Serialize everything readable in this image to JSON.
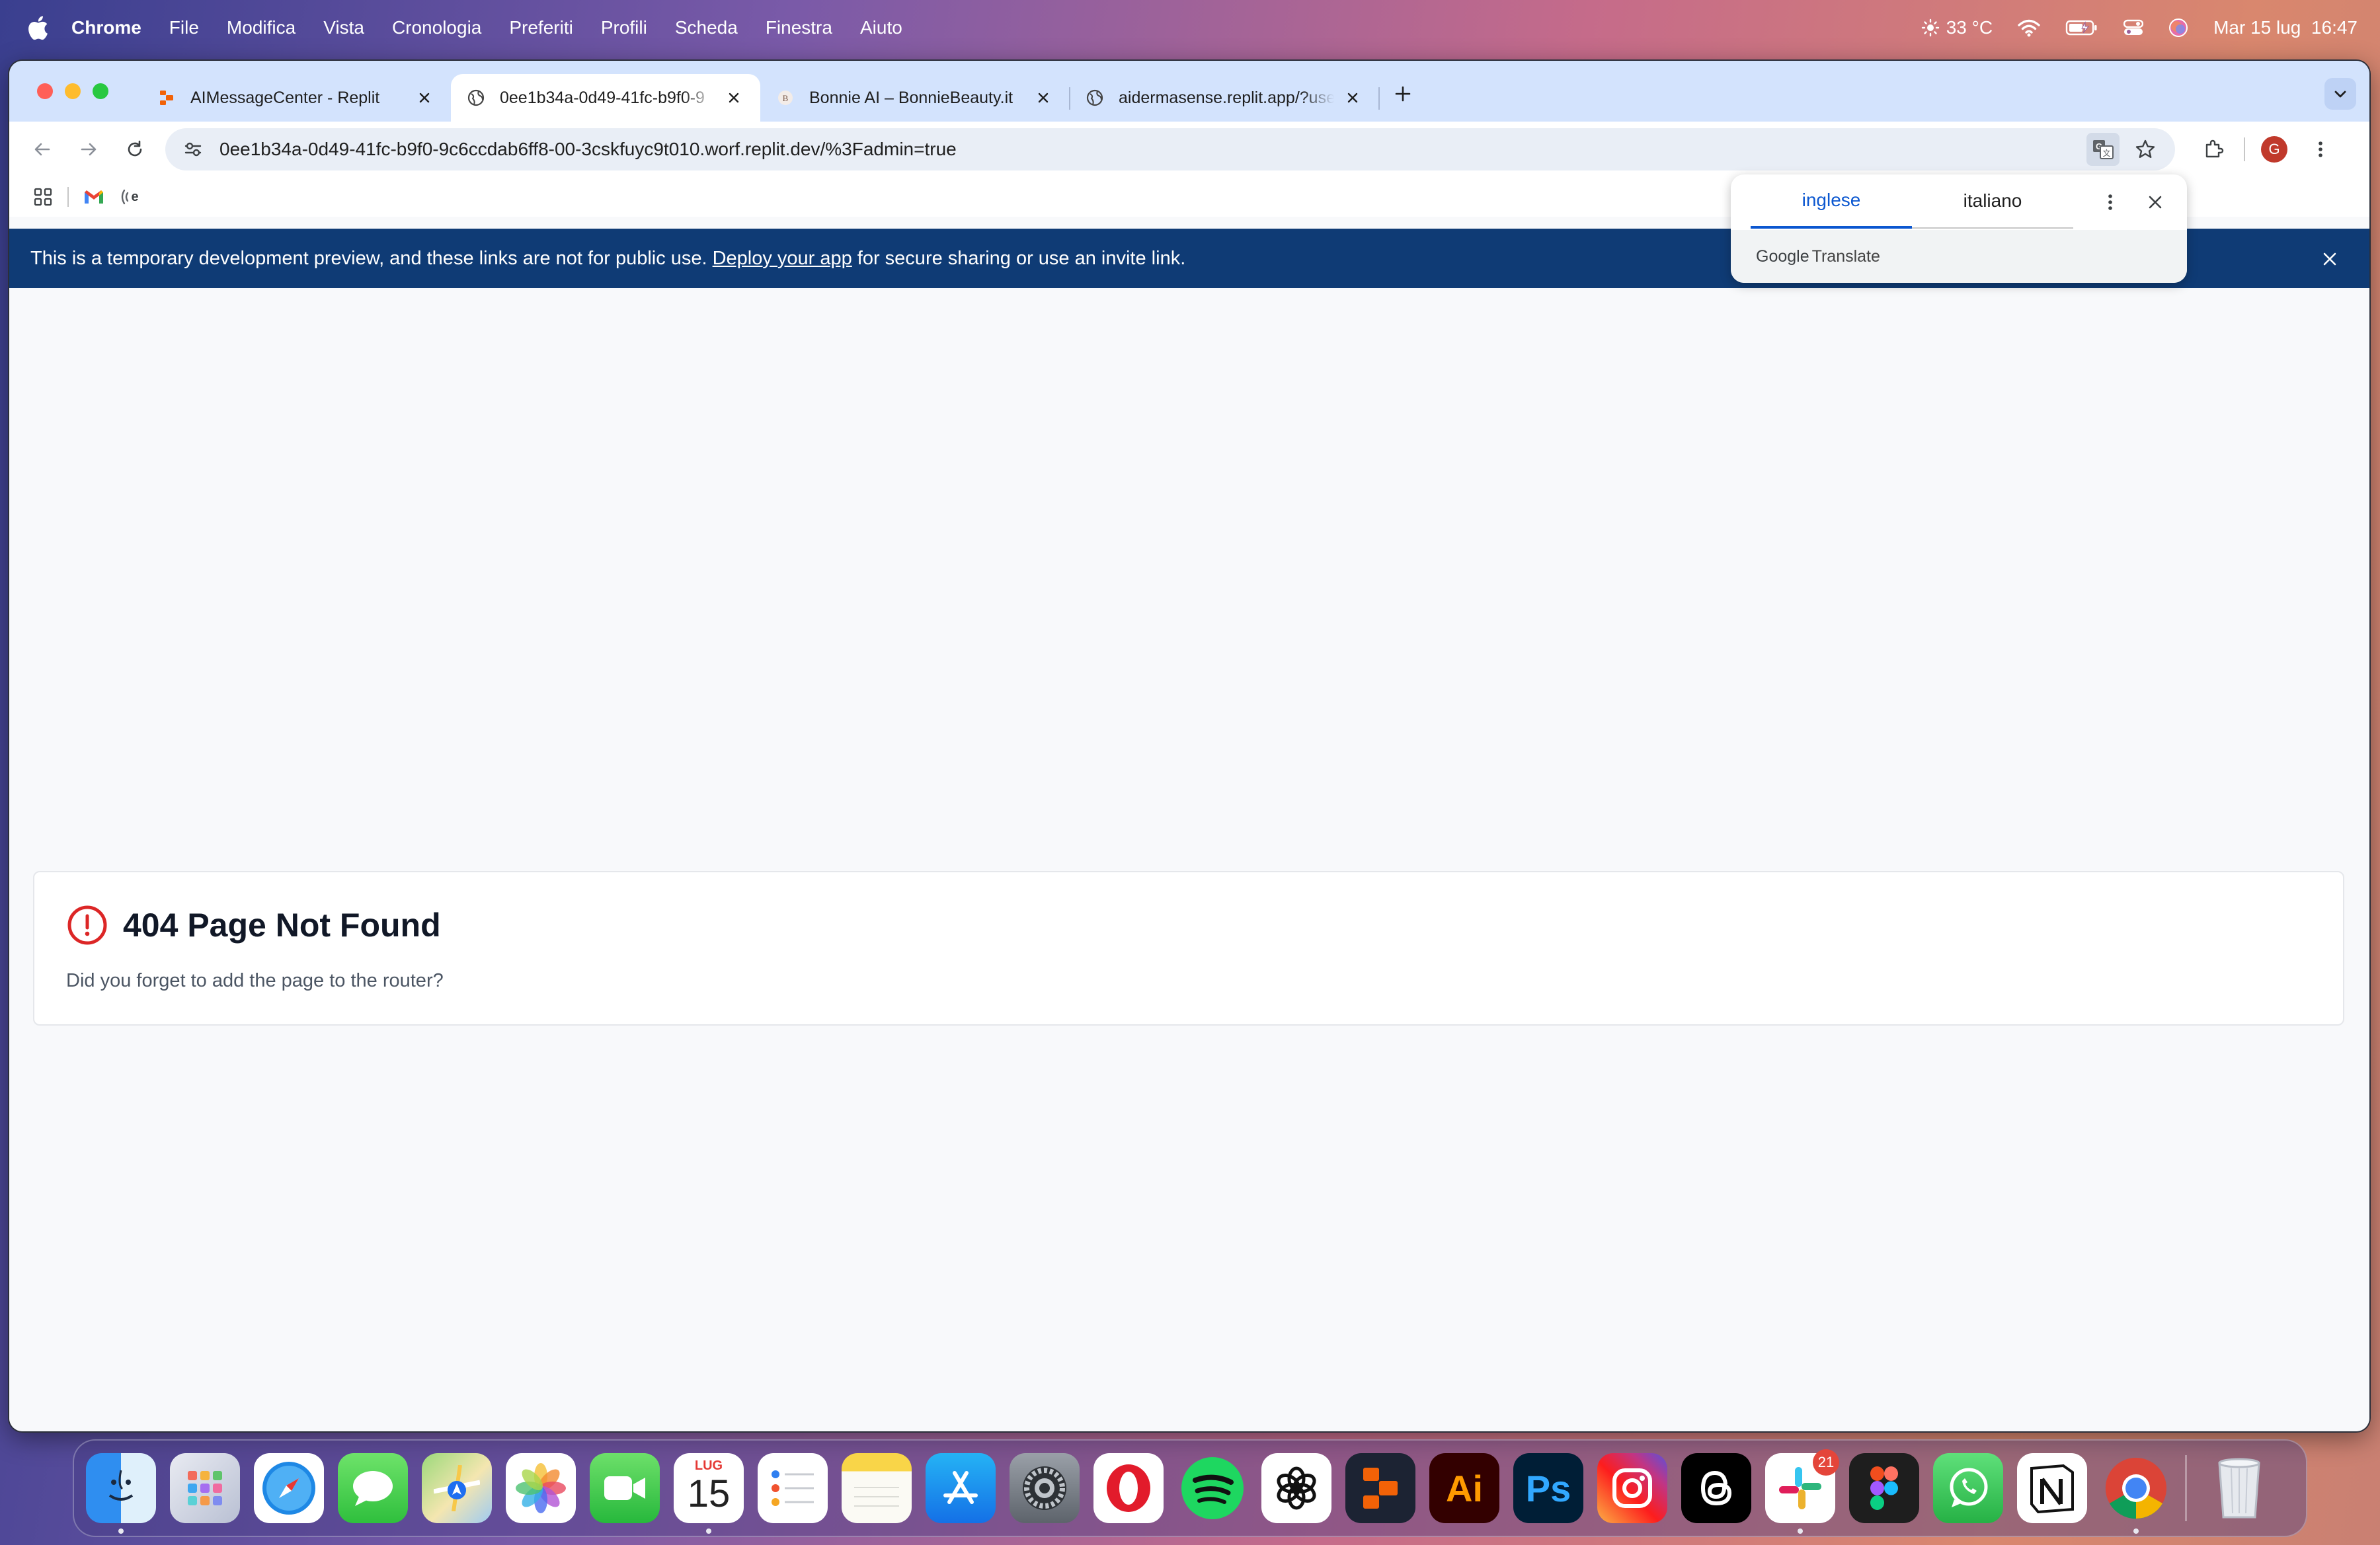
{
  "menubar": {
    "app": "Chrome",
    "items": [
      "File",
      "Modifica",
      "Vista",
      "Cronologia",
      "Preferiti",
      "Profili",
      "Scheda",
      "Finestra",
      "Aiuto"
    ],
    "weather": "33 °C",
    "datetime": "Mar 15 lug  16:47"
  },
  "tabs": [
    {
      "title": "AIMessageCenter - Replit",
      "favicon": "replit-icon",
      "active": false
    },
    {
      "title": "0ee1b34a-0d49-41fc-b9f0-9",
      "favicon": "globe-icon",
      "active": true
    },
    {
      "title": "Bonnie AI – BonnieBeauty.it",
      "favicon": "bonnie-icon",
      "active": false
    },
    {
      "title": "aidermasense.replit.app/?use",
      "favicon": "globe-icon",
      "active": false
    }
  ],
  "toolbar": {
    "url": "0ee1b34a-0d49-41fc-b9f0-9c6ccdab6ff8-00-3cskfuyc9t010.worf.replit.dev/%3Fadmin=true",
    "profile_initial": "G"
  },
  "banner": {
    "text_before": "This is a temporary development preview, and these links are not for public use.",
    "link": "Deploy your app",
    "text_after": "for secure sharing or use an invite link."
  },
  "translate": {
    "source": "inglese",
    "target": "italiano",
    "brand_google": "Google",
    "brand_translate": "Translate"
  },
  "page": {
    "title": "404 Page Not Found",
    "message": "Did you forget to add the page to the router?"
  },
  "dock": {
    "calendar_month": "LUG",
    "calendar_day": "15",
    "slack_badge": "21",
    "apps": [
      "finder",
      "launchpad",
      "safari",
      "messages",
      "maps",
      "photos",
      "facetime",
      "calendar",
      "reminders",
      "notes",
      "app-store",
      "system-settings",
      "opera",
      "spotify",
      "chatgpt",
      "replit",
      "illustrator",
      "photoshop",
      "instagram",
      "threads",
      "slack",
      "figma",
      "whatsapp",
      "notion",
      "chrome",
      "trash"
    ]
  },
  "colors": {
    "banner": "#0f3b75",
    "tabstrip": "#d3e3fd",
    "accent": "#0b57d0",
    "error": "#dc2626"
  }
}
